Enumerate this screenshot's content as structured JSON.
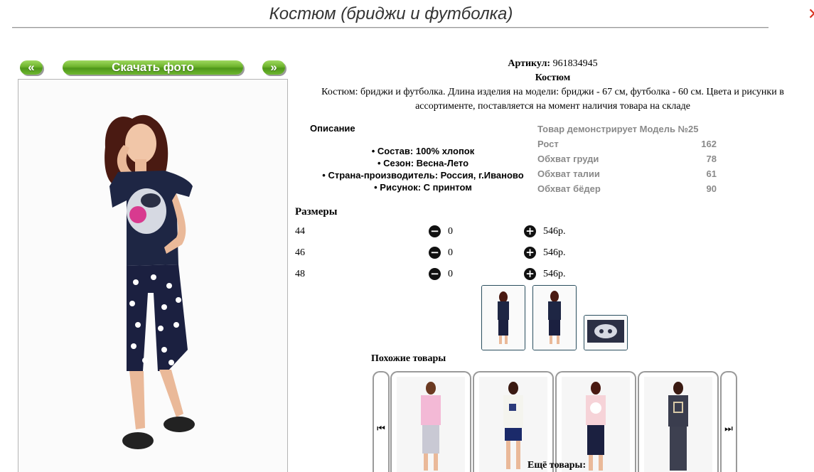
{
  "header": {
    "title": "Костюм (бриджи и футболка)",
    "close_icon": "close-icon",
    "close_glyph": "✕"
  },
  "gallery": {
    "prev_label": "«",
    "download_label": "Скачать фото",
    "next_label": "»"
  },
  "product": {
    "article_label": "Артикул:",
    "article_value": "961834945",
    "name": "Костюм",
    "description": "Костюм: бриджи и футболка. Длина изделия на модели: бриджи - 67 см, футболка - 60 см. Цвета и рисунки в ассортименте, поставляется на момент наличия товара на складе"
  },
  "details": {
    "title": "Описание",
    "bullet": "•",
    "features": [
      "Состав: 100% хлопок",
      "Сезон: Весна-Лето",
      "Страна-производитель: Россия, г.Иваново",
      "Рисунок: С принтом"
    ]
  },
  "model": {
    "rows": [
      {
        "label": "Товар демонстрирует Модель №25",
        "value": ""
      },
      {
        "label": "Рост",
        "value": "162"
      },
      {
        "label": "Обхват груди",
        "value": "78"
      },
      {
        "label": "Обхват талии",
        "value": "61"
      },
      {
        "label": "Обхват бёдер",
        "value": "90"
      }
    ]
  },
  "sizes": {
    "title": "Размеры",
    "minus_glyph": "−",
    "plus_glyph": "+",
    "rows": [
      {
        "size": "44",
        "qty": "0",
        "price": "546р."
      },
      {
        "size": "46",
        "qty": "0",
        "price": "546р."
      },
      {
        "size": "48",
        "qty": "0",
        "price": "546р."
      }
    ]
  },
  "similar": {
    "title": "Похожие товары",
    "prev_glyph": "⏮",
    "next_glyph": "⏭"
  },
  "more": {
    "title": "Ещё товары:"
  },
  "colors": {
    "green_button": "#6db32c",
    "thumb_border": "#2a4e5e",
    "model_text": "#8a8a8a",
    "close": "#d9301e"
  }
}
